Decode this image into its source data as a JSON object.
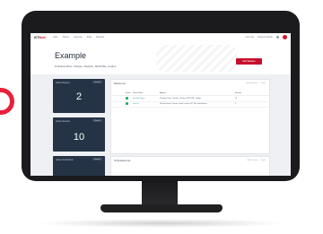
{
  "app": {
    "logo": {
      "main": "ICT",
      "accent": "Work"
    },
    "nav": [
      "Jobs",
      "Teams",
      "Sources",
      "Files",
      "Reports"
    ],
    "user": {
      "org": "Your org",
      "name": "Support Admin"
    }
  },
  "page": {
    "title": "Example",
    "subtitle": "8 Nimbus Drive, Chester, Cheshire, SK20 6NL, London",
    "edit_button": "Edit Sitebase"
  },
  "cards": [
    {
      "label": "Active Devices",
      "button": "View all",
      "value": "2"
    },
    {
      "label": "Active Sensors",
      "button": "View all",
      "value": "10"
    },
    {
      "label": "Active Technicians",
      "button": "View all",
      "value": ""
    }
  ],
  "devices_panel": {
    "title": "Device List",
    "tools": [
      "Add New Device",
      "Export"
    ],
    "columns": [
      "Status",
      "Device Name",
      "Address",
      "Sensors"
    ],
    "rows": [
      {
        "name": "Example Device",
        "address": "8 Nimbus Drive, Chester, Cheshire, SK20 6NL, London",
        "sensors": "10"
      },
      {
        "name": "Device 1",
        "address": "28 Bank Street, Chester, South London, ST2 1A, United States",
        "sensors": "5"
      }
    ]
  },
  "technicians_panel": {
    "title": "Technicians List",
    "tools": [
      "Add Technician",
      "Export"
    ]
  },
  "colors": {
    "accent": "#c8102e",
    "card": "#243446",
    "status_ok": "#22a860",
    "ring": "#e8203a"
  }
}
